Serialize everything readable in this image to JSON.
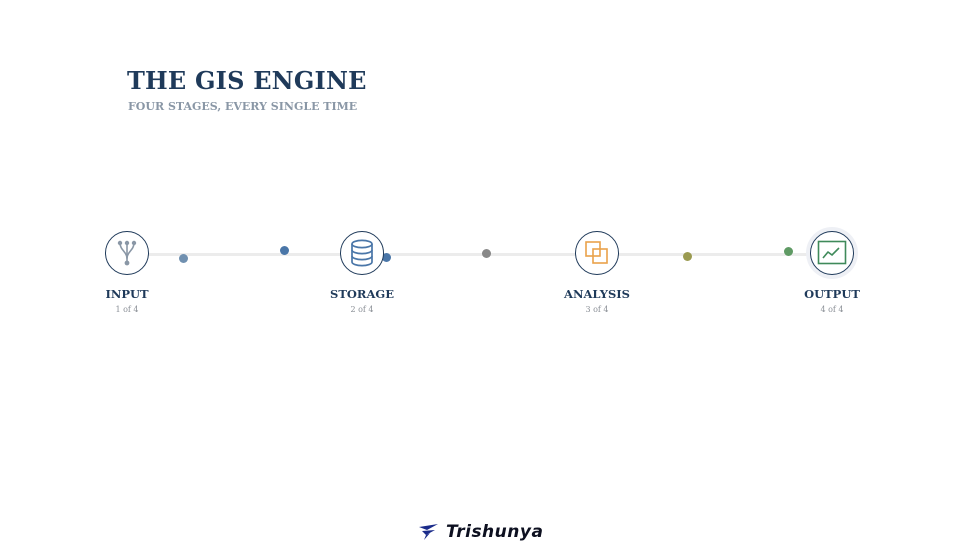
{
  "header": {
    "title": "THE GIS ENGINE",
    "subtitle": "FOUR STAGES, EVERY SINGLE TIME"
  },
  "stages": [
    {
      "label": "INPUT",
      "count": "1 of 4",
      "icon": "input-fork-icon",
      "color": "#8a97a6"
    },
    {
      "label": "STORAGE",
      "count": "2 of 4",
      "icon": "database-icon",
      "color": "#4a76a8"
    },
    {
      "label": "ANALYSIS",
      "count": "3 of 4",
      "icon": "overlap-squares-icon",
      "color": "#e9a24a"
    },
    {
      "label": "OUTPUT",
      "count": "4 of 4",
      "icon": "line-chart-icon",
      "color": "#3f8a5a"
    }
  ],
  "connector_dot_colors": [
    "#7090b0",
    "#4a76a8",
    "#4a76a8",
    "#888888",
    "#9a9a50",
    "#5f9a64"
  ],
  "footer": {
    "brand": "Trishunya",
    "logo_icon": "bird-logo-icon"
  }
}
